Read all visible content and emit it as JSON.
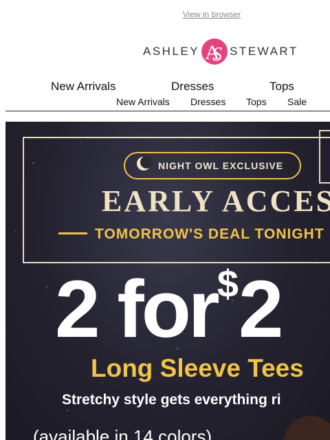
{
  "header": {
    "view_in_browser": "View in browser"
  },
  "brand": {
    "word_left": "ASHLEY",
    "word_right": "STEWART",
    "monogram": "AS",
    "monogram_color": "#e5437e"
  },
  "nav_primary": [
    "New Arrivals",
    "Dresses",
    "Tops"
  ],
  "nav_secondary": [
    "New Arrivals",
    "Dresses",
    "Tops",
    "Sale"
  ],
  "hero": {
    "badge": "NIGHT OWL EXCLUSIVE",
    "headline": "EARLY ACCESS",
    "subline": "TOMORROW'S DEAL TONIGHT",
    "offer_main": "2 for",
    "offer_currency": "$",
    "offer_value": "2",
    "product": "Long Sleeve Tees",
    "tagline": "Stretchy style gets everything ri",
    "availability": "(available in 14 colors)",
    "accent_color": "#f0c34a",
    "bg_color": "#24222f"
  }
}
